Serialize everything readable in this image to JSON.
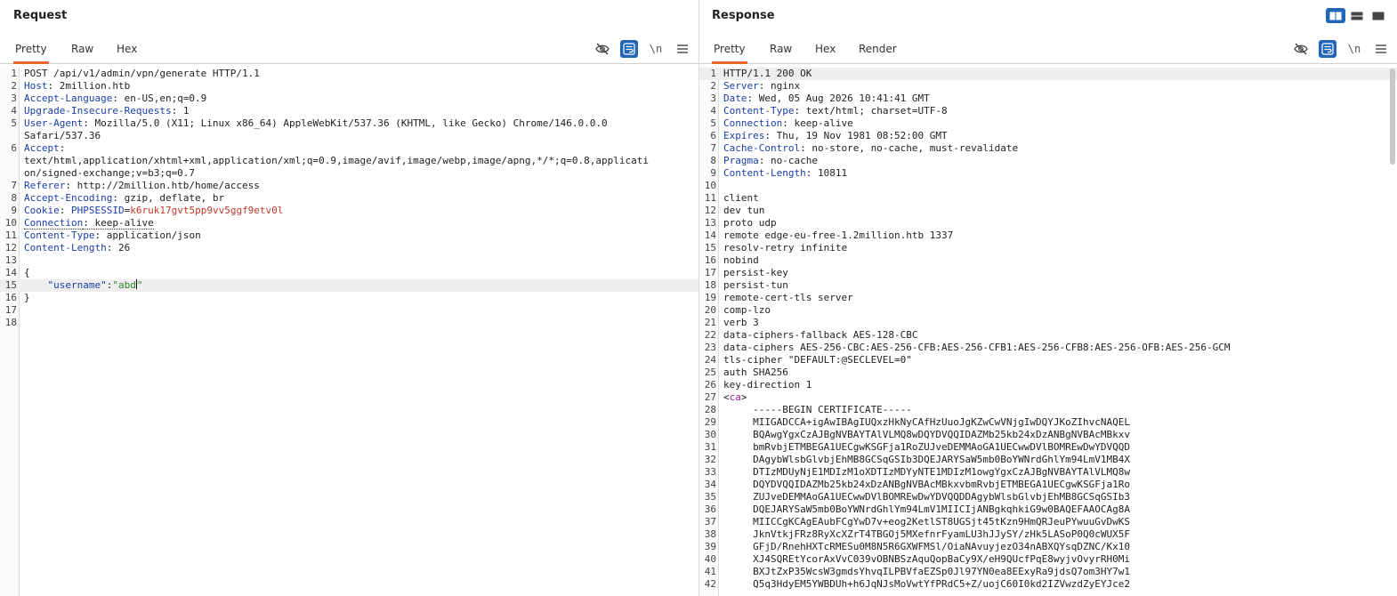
{
  "request": {
    "title": "Request",
    "tabs": [
      "Pretty",
      "Raw",
      "Hex"
    ],
    "active_tab": "Pretty",
    "tools": {
      "hide": "eye-slash-icon",
      "wrap": "wrap-icon",
      "newline": "\\n",
      "menu": "menu-icon"
    },
    "lines": [
      {
        "n": "1",
        "parts": [
          {
            "t": "POST /api/v1/admin/vpn/generate HTTP/1.1",
            "c": "hval"
          }
        ]
      },
      {
        "n": "2",
        "parts": [
          {
            "t": "Host",
            "c": "hname"
          },
          {
            "t": ": 2million.htb",
            "c": "hval"
          }
        ]
      },
      {
        "n": "3",
        "parts": [
          {
            "t": "Accept-Language",
            "c": "hname"
          },
          {
            "t": ": en-US,en;q=0.9",
            "c": "hval"
          }
        ]
      },
      {
        "n": "4",
        "parts": [
          {
            "t": "Upgrade-Insecure-Requests",
            "c": "hname"
          },
          {
            "t": ": 1",
            "c": "hval"
          }
        ]
      },
      {
        "n": "5",
        "parts": [
          {
            "t": "User-Agent",
            "c": "hname"
          },
          {
            "t": ": Mozilla/5.0 (X11; Linux x86_64) AppleWebKit/537.36 (KHTML, like Gecko) Chrome/146.0.0.0",
            "c": "hval"
          }
        ]
      },
      {
        "n": "",
        "cont": true,
        "parts": [
          {
            "t": "Safari/537.36",
            "c": "hval"
          }
        ]
      },
      {
        "n": "6",
        "parts": [
          {
            "t": "Accept",
            "c": "hname"
          },
          {
            "t": ":",
            "c": "hval"
          }
        ]
      },
      {
        "n": "",
        "cont": true,
        "parts": [
          {
            "t": "text/html,application/xhtml+xml,application/xml;q=0.9,image/avif,image/webp,image/apng,*/*;q=0.8,applicati",
            "c": "hval"
          }
        ]
      },
      {
        "n": "",
        "cont": true,
        "parts": [
          {
            "t": "on/signed-exchange;v=b3;q=0.7",
            "c": "hval"
          }
        ]
      },
      {
        "n": "7",
        "parts": [
          {
            "t": "Referer",
            "c": "hname"
          },
          {
            "t": ": http://2million.htb/home/access",
            "c": "hval"
          }
        ]
      },
      {
        "n": "8",
        "parts": [
          {
            "t": "Accept-Encoding",
            "c": "hname"
          },
          {
            "t": ": gzip, deflate, br",
            "c": "hval"
          }
        ]
      },
      {
        "n": "9",
        "parts": [
          {
            "t": "Cookie",
            "c": "hname"
          },
          {
            "t": ": ",
            "c": "hval"
          },
          {
            "t": "PHPSESSID",
            "c": "cookie-name"
          },
          {
            "t": "=",
            "c": "hval"
          },
          {
            "t": "k6ruk17gvt5pp9vv5ggf9etv0l",
            "c": "cookie-val"
          }
        ]
      },
      {
        "n": "10",
        "parts": [
          {
            "t": "Connection",
            "c": "hname dotted"
          },
          {
            "t": ": keep-alive",
            "c": "hval dotted"
          }
        ]
      },
      {
        "n": "11",
        "parts": [
          {
            "t": "Content-Type",
            "c": "hname"
          },
          {
            "t": ": application/json",
            "c": "hval"
          }
        ]
      },
      {
        "n": "12",
        "parts": [
          {
            "t": "Content-Length",
            "c": "hname"
          },
          {
            "t": ": 26",
            "c": "hval"
          }
        ]
      },
      {
        "n": "13",
        "parts": []
      },
      {
        "n": "14",
        "parts": [
          {
            "t": "{",
            "c": "hval"
          }
        ]
      },
      {
        "n": "15",
        "hl": true,
        "parts": [
          {
            "t": "    ",
            "c": "hval"
          },
          {
            "t": "\"username\"",
            "c": "json-key"
          },
          {
            "t": ":",
            "c": "hval"
          },
          {
            "t": "\"abd\"",
            "c": "json-str",
            "caret": true
          }
        ]
      },
      {
        "n": "16",
        "parts": [
          {
            "t": "}",
            "c": "hval"
          }
        ]
      },
      {
        "n": "17",
        "parts": []
      },
      {
        "n": "18",
        "parts": []
      }
    ]
  },
  "response": {
    "title": "Response",
    "tabs": [
      "Pretty",
      "Raw",
      "Hex",
      "Render"
    ],
    "active_tab": "Pretty",
    "tools": {
      "hide": "eye-slash-icon",
      "wrap": "wrap-icon",
      "newline": "\\n",
      "menu": "menu-icon"
    },
    "layout_toggle": [
      "split-vertical-icon",
      "split-horizontal-icon",
      "single-pane-icon"
    ],
    "lines": [
      {
        "n": "1",
        "hl": true,
        "parts": [
          {
            "t": "HTTP/1.1 200 OK",
            "c": "hval"
          }
        ]
      },
      {
        "n": "2",
        "parts": [
          {
            "t": "Server",
            "c": "hname"
          },
          {
            "t": ": nginx",
            "c": "hval"
          }
        ]
      },
      {
        "n": "3",
        "parts": [
          {
            "t": "Date",
            "c": "hname"
          },
          {
            "t": ": Wed, 05 Aug 2026 10:41:41 GMT",
            "c": "hval"
          }
        ]
      },
      {
        "n": "4",
        "parts": [
          {
            "t": "Content-Type",
            "c": "hname"
          },
          {
            "t": ": text/html; charset=UTF-8",
            "c": "hval"
          }
        ]
      },
      {
        "n": "5",
        "parts": [
          {
            "t": "Connection",
            "c": "hname"
          },
          {
            "t": ": keep-alive",
            "c": "hval"
          }
        ]
      },
      {
        "n": "6",
        "parts": [
          {
            "t": "Expires",
            "c": "hname"
          },
          {
            "t": ": Thu, 19 Nov 1981 08:52:00 GMT",
            "c": "hval"
          }
        ]
      },
      {
        "n": "7",
        "parts": [
          {
            "t": "Cache-Control",
            "c": "hname"
          },
          {
            "t": ": no-store, no-cache, must-revalidate",
            "c": "hval"
          }
        ]
      },
      {
        "n": "8",
        "parts": [
          {
            "t": "Pragma",
            "c": "hname"
          },
          {
            "t": ": no-cache",
            "c": "hval"
          }
        ]
      },
      {
        "n": "9",
        "parts": [
          {
            "t": "Content-Length",
            "c": "hname"
          },
          {
            "t": ": 10811",
            "c": "hval"
          }
        ]
      },
      {
        "n": "10",
        "parts": []
      },
      {
        "n": "11",
        "parts": [
          {
            "t": "client",
            "c": "hval"
          }
        ]
      },
      {
        "n": "12",
        "parts": [
          {
            "t": "dev tun",
            "c": "hval"
          }
        ]
      },
      {
        "n": "13",
        "parts": [
          {
            "t": "proto udp",
            "c": "hval"
          }
        ]
      },
      {
        "n": "14",
        "parts": [
          {
            "t": "remote edge-eu-free-1.2million.htb 1337",
            "c": "hval"
          }
        ]
      },
      {
        "n": "15",
        "parts": [
          {
            "t": "resolv-retry infinite",
            "c": "hval"
          }
        ]
      },
      {
        "n": "16",
        "parts": [
          {
            "t": "nobind",
            "c": "hval"
          }
        ]
      },
      {
        "n": "17",
        "parts": [
          {
            "t": "persist-key",
            "c": "hval"
          }
        ]
      },
      {
        "n": "18",
        "parts": [
          {
            "t": "persist-tun",
            "c": "hval"
          }
        ]
      },
      {
        "n": "19",
        "parts": [
          {
            "t": "remote-cert-tls server",
            "c": "hval"
          }
        ]
      },
      {
        "n": "20",
        "parts": [
          {
            "t": "comp-lzo",
            "c": "hval"
          }
        ]
      },
      {
        "n": "21",
        "parts": [
          {
            "t": "verb 3",
            "c": "hval"
          }
        ]
      },
      {
        "n": "22",
        "parts": [
          {
            "t": "data-ciphers-fallback AES-128-CBC",
            "c": "hval"
          }
        ]
      },
      {
        "n": "23",
        "parts": [
          {
            "t": "data-ciphers AES-256-CBC:AES-256-CFB:AES-256-CFB1:AES-256-CFB8:AES-256-OFB:AES-256-GCM",
            "c": "hval"
          }
        ]
      },
      {
        "n": "24",
        "parts": [
          {
            "t": "tls-cipher \"DEFAULT:@SECLEVEL=0\"",
            "c": "hval"
          }
        ]
      },
      {
        "n": "25",
        "parts": [
          {
            "t": "auth SHA256",
            "c": "hval"
          }
        ]
      },
      {
        "n": "26",
        "parts": [
          {
            "t": "key-direction 1",
            "c": "hval"
          }
        ]
      },
      {
        "n": "27",
        "parts": [
          {
            "t": "<",
            "c": "hval"
          },
          {
            "t": "ca",
            "c": "tag"
          },
          {
            "t": ">",
            "c": "hval"
          }
        ]
      },
      {
        "n": "28",
        "parts": [
          {
            "t": "     -----BEGIN CERTIFICATE-----",
            "c": "hval"
          }
        ]
      },
      {
        "n": "29",
        "parts": [
          {
            "t": "     MIIGADCCA+igAwIBAgIUQxzHkNyCAfHzUuoJgKZwCwVNjgIwDQYJKoZIhvcNAQEL",
            "c": "hval"
          }
        ]
      },
      {
        "n": "30",
        "parts": [
          {
            "t": "     BQAwgYgxCzAJBgNVBAYTAlVLMQ8wDQYDVQQIDAZMb25kb24xDzANBgNVBAcMBkxv",
            "c": "hval"
          }
        ]
      },
      {
        "n": "31",
        "parts": [
          {
            "t": "     bmRvbjETMBEGA1UECgwKSGFja1RoZUJveDEMMAoGA1UECwwDVlBOMREwDwYDVQQD",
            "c": "hval"
          }
        ]
      },
      {
        "n": "32",
        "parts": [
          {
            "t": "     DAgybWlsbGlvbjEhMB8GCSqGSIb3DQEJARYSaW5mb0BoYWNrdGhlYm94LmV1MB4X",
            "c": "hval"
          }
        ]
      },
      {
        "n": "33",
        "parts": [
          {
            "t": "     DTIzMDUyNjE1MDIzM1oXDTIzMDYyNTE1MDIzM1owgYgxCzAJBgNVBAYTAlVLMQ8w",
            "c": "hval"
          }
        ]
      },
      {
        "n": "34",
        "parts": [
          {
            "t": "     DQYDVQQIDAZMb25kb24xDzANBgNVBAcMBkxvbmRvbjETMBEGA1UECgwKSGFja1Ro",
            "c": "hval"
          }
        ]
      },
      {
        "n": "35",
        "parts": [
          {
            "t": "     ZUJveDEMMAoGA1UECwwDVlBOMREwDwYDVQQDDAgybWlsbGlvbjEhMB8GCSqGSIb3",
            "c": "hval"
          }
        ]
      },
      {
        "n": "36",
        "parts": [
          {
            "t": "     DQEJARYSaW5mb0BoYWNrdGhlYm94LmV1MIICIjANBgkqhkiG9w0BAQEFAAOCAg8A",
            "c": "hval"
          }
        ]
      },
      {
        "n": "37",
        "parts": [
          {
            "t": "     MIICCgKCAgEAubFCgYwD7v+eog2KetlST8UGSjt45tKzn9HmQRJeuPYwuuGvDwKS",
            "c": "hval"
          }
        ]
      },
      {
        "n": "38",
        "parts": [
          {
            "t": "     JknVtkjFRz8RyXcXZrT4TBGOj5MXefnrFyamLU3hJJySY/zHk5LASoP0Q0cWUX5F",
            "c": "hval"
          }
        ]
      },
      {
        "n": "39",
        "parts": [
          {
            "t": "     GFjD/RnehHXTcRMESu0M8N5R6GXWFMSl/OiaNAvuyjezO34nABXQYsqDZNC/Kx10",
            "c": "hval"
          }
        ]
      },
      {
        "n": "40",
        "parts": [
          {
            "t": "     XJ4SQREtYcorAxVvC039vOBNBSzAquQopBaCy9X/eH9QUcfPqE8wyjvOvyrRH0Mi",
            "c": "hval"
          }
        ]
      },
      {
        "n": "41",
        "parts": [
          {
            "t": "     BXJtZxP35WcsW3gmdsYhvqILPBVfaEZSp0Jl97YN0ea8EExyRa9jdsQ7om3HY7w1",
            "c": "hval"
          }
        ]
      },
      {
        "n": "42",
        "parts": [
          {
            "t": "     Q5q3HdyEM5YWBDUh+h6JqNJsMoVwtYfPRdC5+Z/uojC60I0kd2IZVwzdZyEYJce2",
            "c": "hval"
          }
        ]
      }
    ]
  }
}
